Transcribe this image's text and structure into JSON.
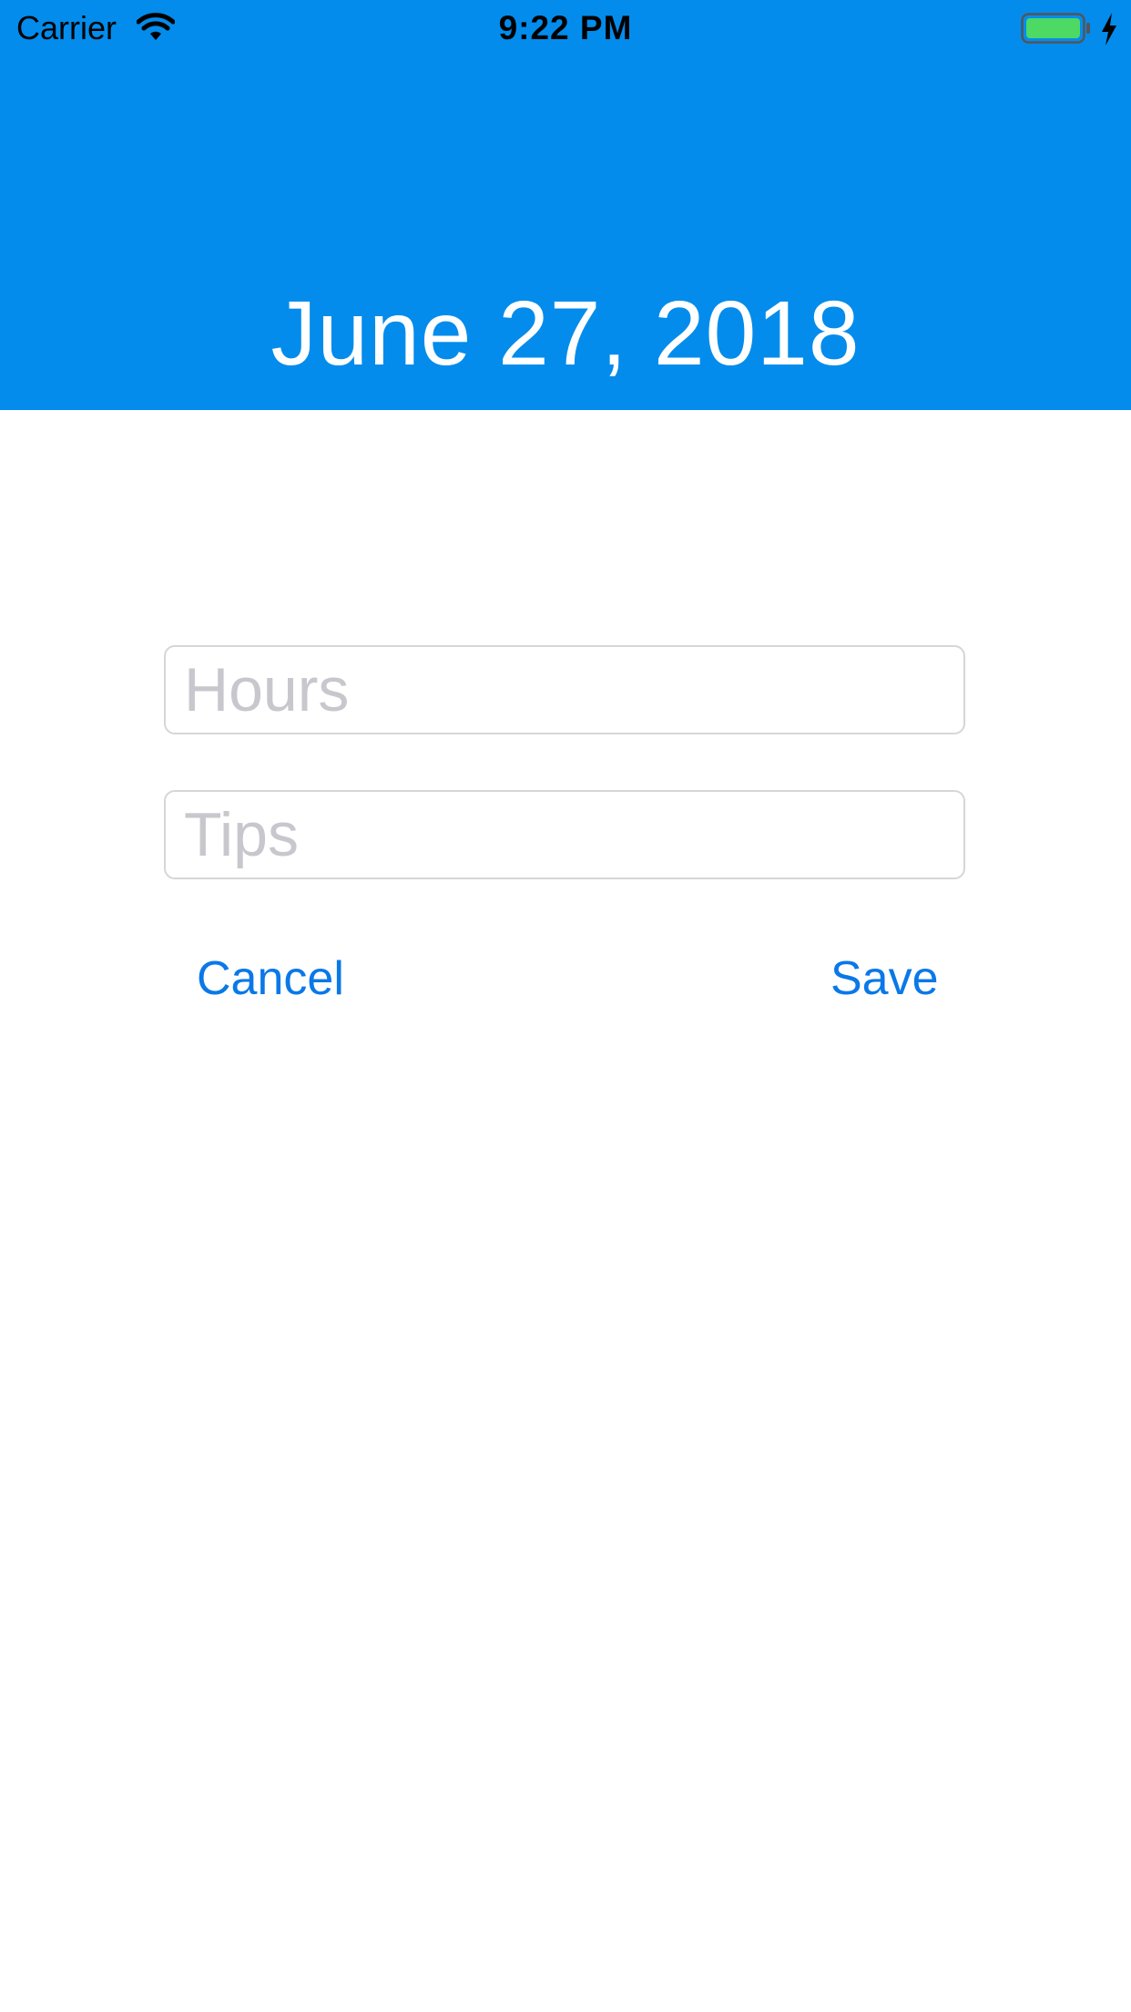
{
  "status_bar": {
    "carrier": "Carrier",
    "time": "9:22 PM",
    "wifi_icon": "wifi-icon",
    "battery_icon": "battery-charging-icon",
    "battery_color": "#4cd964"
  },
  "header": {
    "date": "June 27, 2018",
    "background": "#038cec"
  },
  "form": {
    "hours_placeholder": "Hours",
    "hours_value": "",
    "tips_placeholder": "Tips",
    "tips_value": "",
    "cancel_label": "Cancel",
    "save_label": "Save",
    "button_color": "#0a78e8"
  }
}
